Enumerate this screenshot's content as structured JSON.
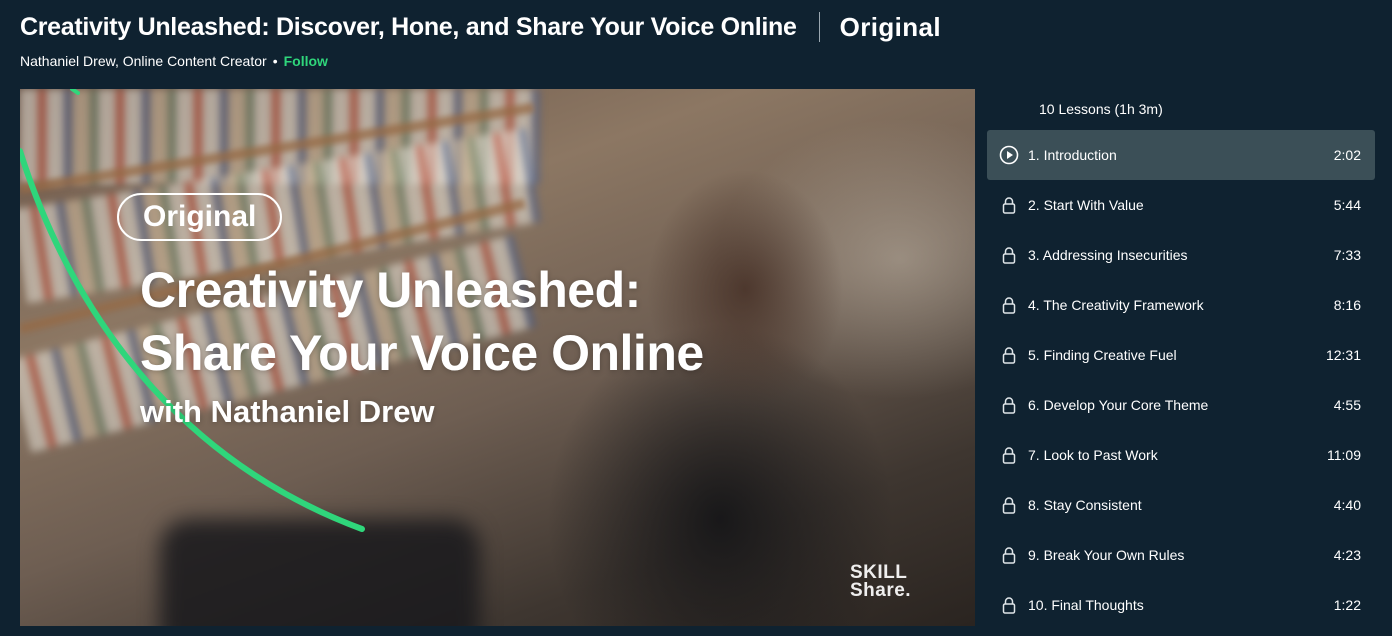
{
  "header": {
    "title": "Creativity Unleashed: Discover, Hone, and Share Your Voice Online",
    "badge": "Original",
    "teacher": "Nathaniel Drew, Online Content Creator",
    "separator": "•",
    "follow_label": "Follow"
  },
  "video": {
    "badge": "Original",
    "title_line1": "Creativity Unleashed:",
    "title_line2": "Share Your Voice Online",
    "subtitle": "with Nathaniel Drew",
    "logo_line1": "SKILL",
    "logo_line2": "Share."
  },
  "lessons": {
    "summary": "10 Lessons (1h 3m)",
    "items": [
      {
        "label": "1. Introduction",
        "duration": "2:02",
        "icon": "play-icon",
        "active": true
      },
      {
        "label": "2. Start With Value",
        "duration": "5:44",
        "icon": "lock-icon"
      },
      {
        "label": "3. Addressing Insecurities",
        "duration": "7:33",
        "icon": "lock-icon"
      },
      {
        "label": "4. The Creativity Framework",
        "duration": "8:16",
        "icon": "lock-icon"
      },
      {
        "label": "5. Finding Creative Fuel",
        "duration": "12:31",
        "icon": "lock-icon"
      },
      {
        "label": "6. Develop Your Core Theme",
        "duration": "4:55",
        "icon": "lock-icon"
      },
      {
        "label": "7. Look to Past Work",
        "duration": "11:09",
        "icon": "lock-icon"
      },
      {
        "label": "8. Stay Consistent",
        "duration": "4:40",
        "icon": "lock-icon"
      },
      {
        "label": "9. Break Your Own Rules",
        "duration": "4:23",
        "icon": "lock-icon"
      },
      {
        "label": "10. Final Thoughts",
        "duration": "1:22",
        "icon": "lock-icon"
      }
    ]
  },
  "colors": {
    "background": "#0f2230",
    "accent_green": "#2fd67b",
    "active_row": "#3b4f57"
  }
}
